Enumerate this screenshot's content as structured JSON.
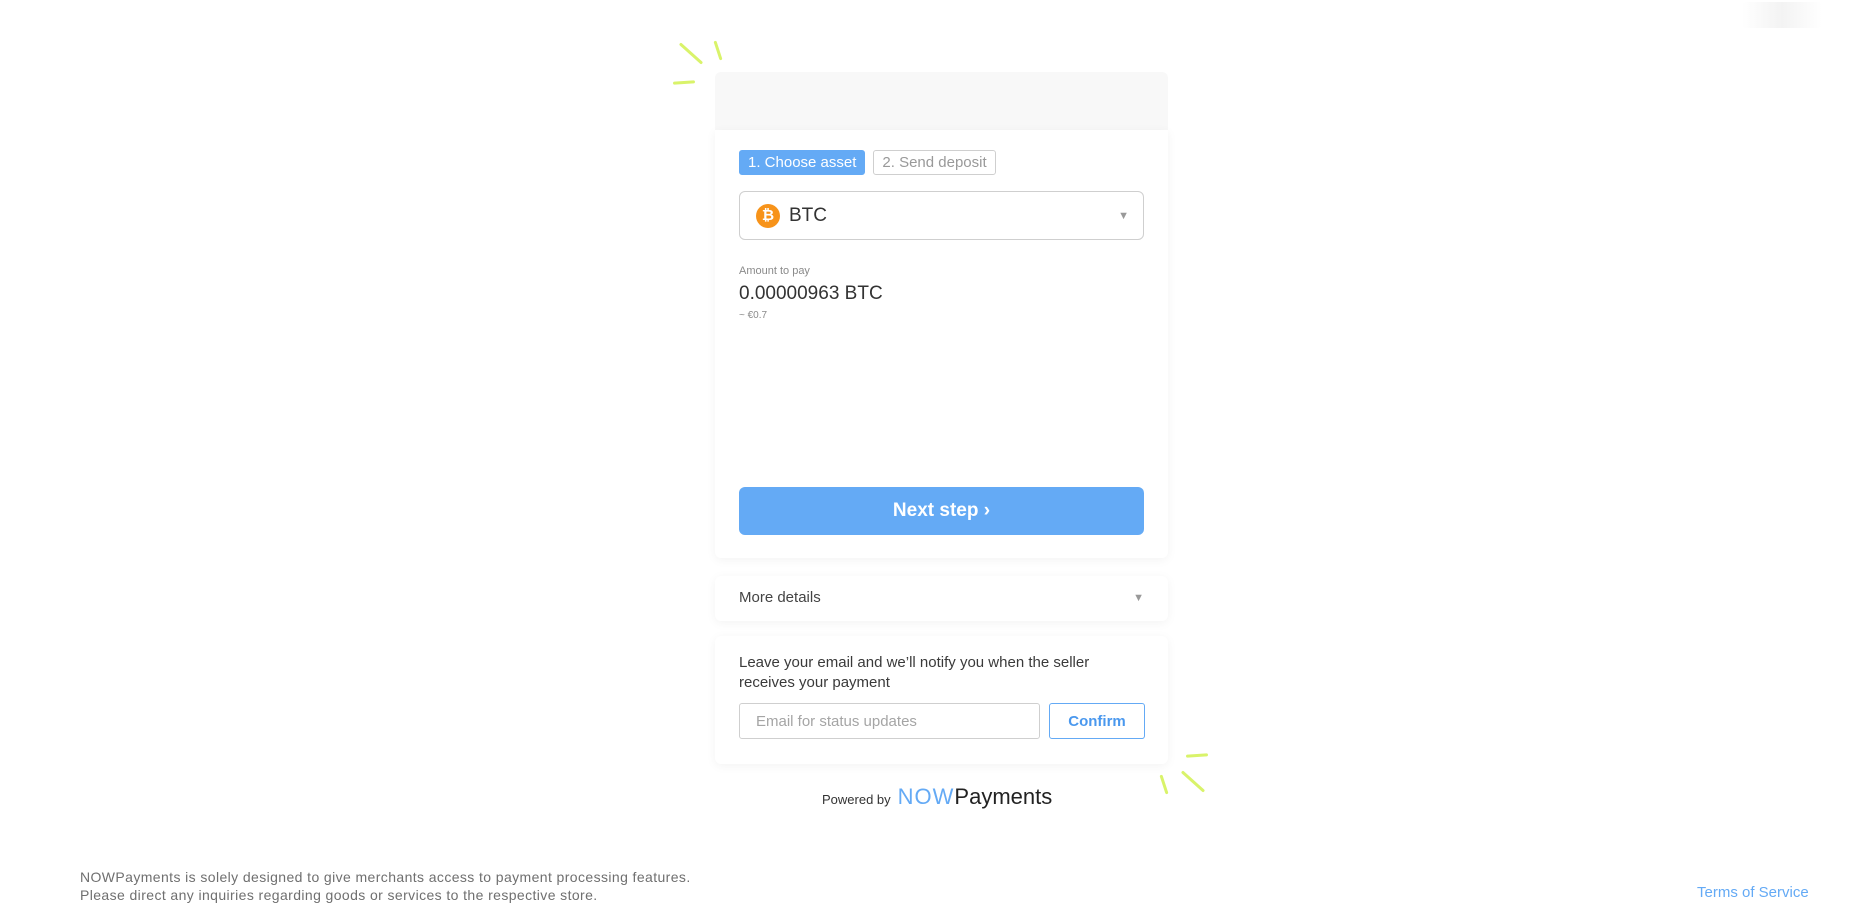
{
  "steps": [
    {
      "label": "1. Choose asset",
      "active": true
    },
    {
      "label": "2. Send deposit",
      "active": false
    }
  ],
  "asset": {
    "icon": "bitcoin-icon",
    "icon_glyph": "₿",
    "selected": "BTC"
  },
  "amount": {
    "label": "Amount to pay",
    "value": "0.00000963 BTC",
    "fiat": "~ €0.7"
  },
  "next_button": "Next step ›",
  "details": {
    "label": "More details"
  },
  "notify": {
    "text": "Leave your email and we’ll notify you when the seller receives your payment",
    "placeholder": "Email for status updates",
    "confirm_label": "Confirm"
  },
  "footer": {
    "powered_label": "Powered by",
    "brand_now": "NOW",
    "brand_payments": "Payments",
    "disclaimer_line1": "NOWPayments is solely designed to give merchants access to payment processing features.",
    "disclaimer_line2": "Please direct any inquiries regarding goods or services to the respective store.",
    "terms_link": "Terms of Service"
  },
  "colors": {
    "accent": "#64aaf5",
    "btc": "#f7931a",
    "sparkle": "#d9f36a"
  }
}
